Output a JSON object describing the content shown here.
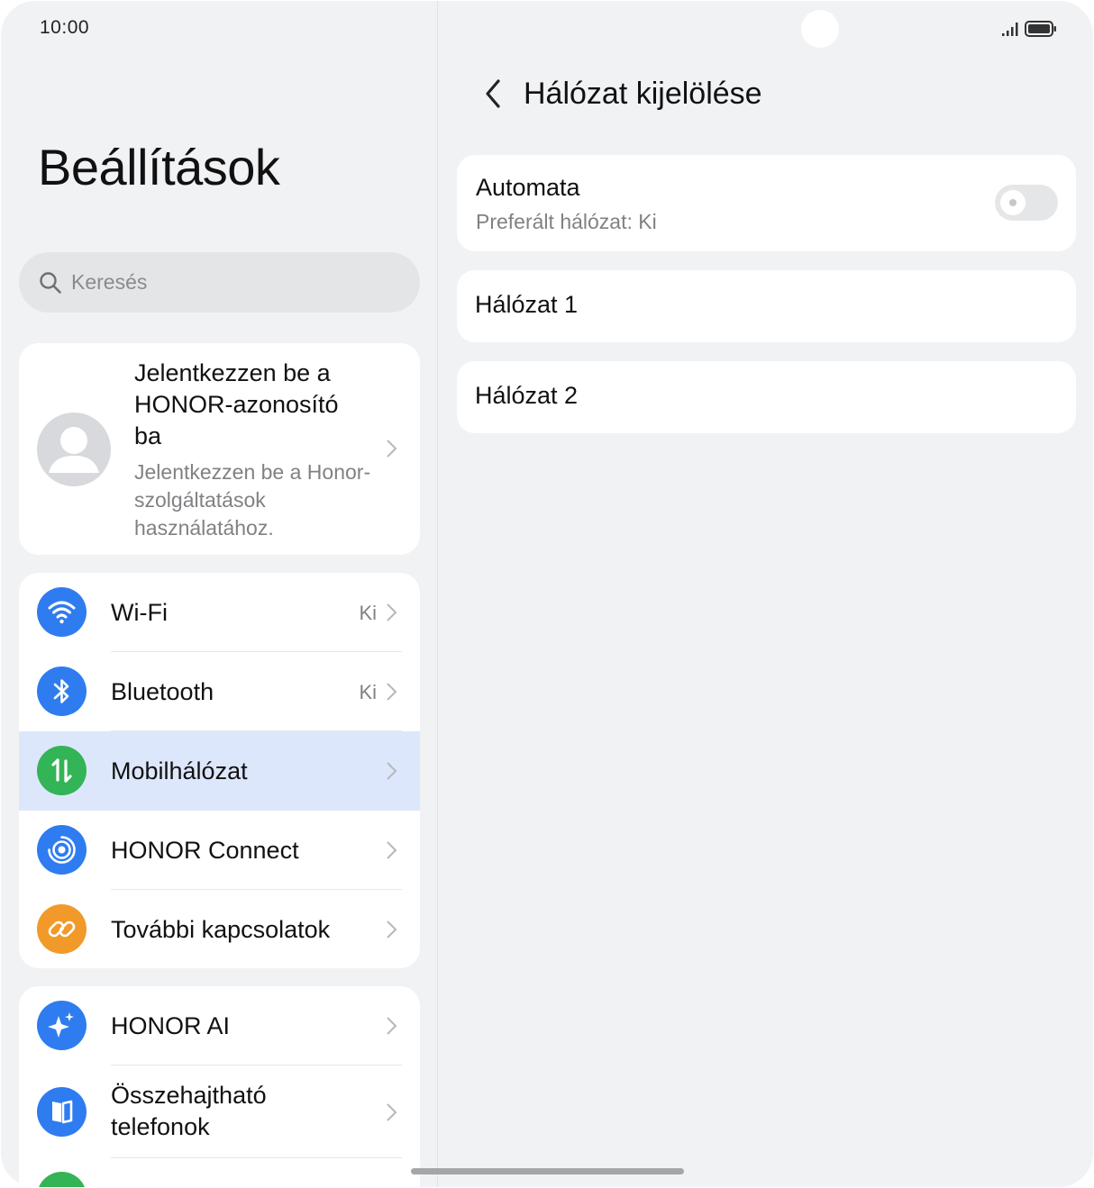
{
  "status_bar": {
    "time": "10:00"
  },
  "left": {
    "title": "Beállítások",
    "search_placeholder": "Keresés",
    "account": {
      "title": "Jelentkezzen be a HONOR-azonosító ba",
      "subtitle": "Jelentkezzen be a Honor-szolgáltatások használatához."
    },
    "group1": [
      {
        "label": "Wi-Fi",
        "value": "Ki",
        "icon": "wifi-icon",
        "color": "#2f7cf0"
      },
      {
        "label": "Bluetooth",
        "value": "Ki",
        "icon": "bluetooth-icon",
        "color": "#2f7cf0"
      },
      {
        "label": "Mobilhálózat",
        "value": "",
        "icon": "mobile-data-icon",
        "color": "#33b456",
        "selected": true
      },
      {
        "label": "HONOR Connect",
        "value": "",
        "icon": "honor-connect-icon",
        "color": "#2f7cf0"
      },
      {
        "label": "További kapcsolatok",
        "value": "",
        "icon": "link-icon",
        "color": "#f19a2a"
      }
    ],
    "group2": [
      {
        "label": "HONOR AI",
        "icon": "sparkle-icon",
        "color": "#2f7cf0"
      },
      {
        "label_line1": "Összehajtható",
        "label_line2": "telefonok",
        "icon": "foldable-icon",
        "color": "#2f7cf0"
      }
    ]
  },
  "right": {
    "title": "Hálózat kijelölése",
    "automata": {
      "title": "Automata",
      "subtitle": "Preferált hálózat: Ki",
      "enabled": false
    },
    "networks": [
      "Hálózat 1",
      "Hálózat 2"
    ]
  }
}
